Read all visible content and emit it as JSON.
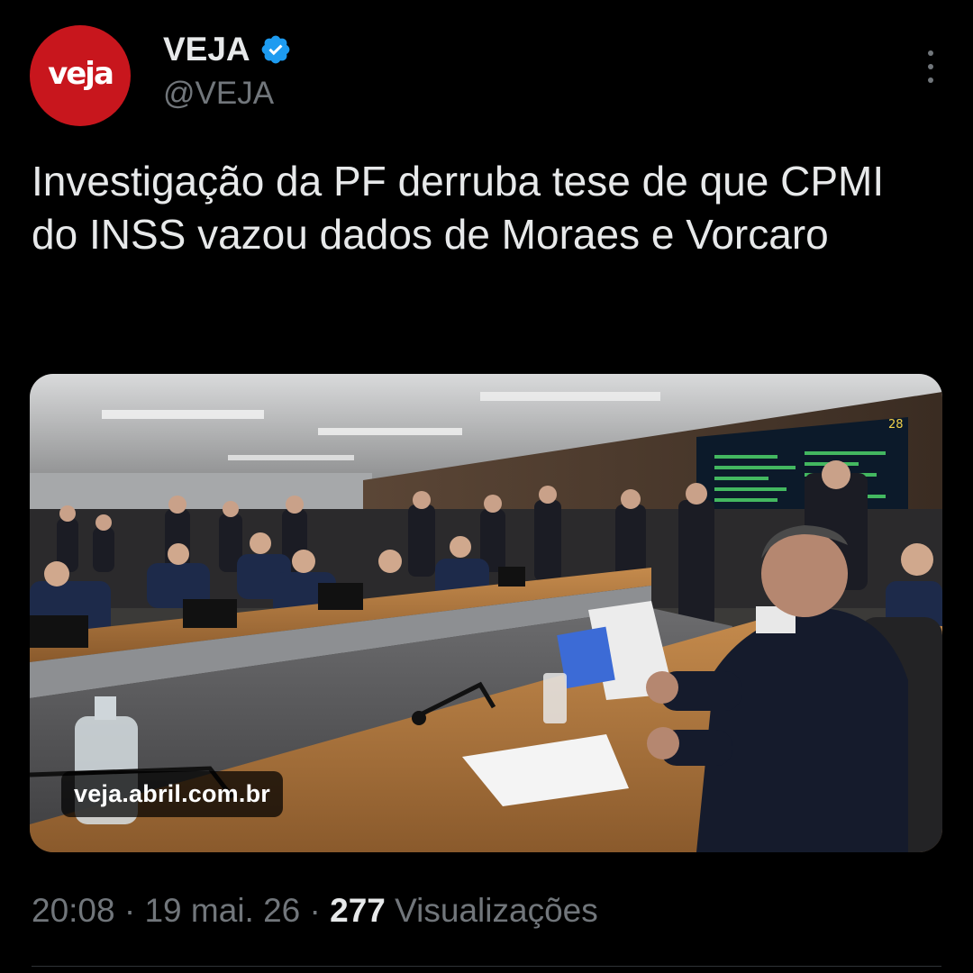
{
  "author": {
    "avatar_text": "veja",
    "display_name": "VEJA",
    "handle": "@VEJA",
    "verified_icon": "verified-badge-icon",
    "brand_color": "#c8161d",
    "verified_color": "#1d9bf0"
  },
  "tweet": {
    "text": "Investigação da PF derruba tese de que CPMI do INSS vazou dados de Moraes e Vorcaro"
  },
  "media": {
    "source_label": "veja.abril.com.br",
    "screen_counter": "28"
  },
  "meta": {
    "time": "20:08",
    "separator": " · ",
    "date": "19 mai. 26",
    "views_count": "277",
    "views_label": "Visualizações"
  }
}
